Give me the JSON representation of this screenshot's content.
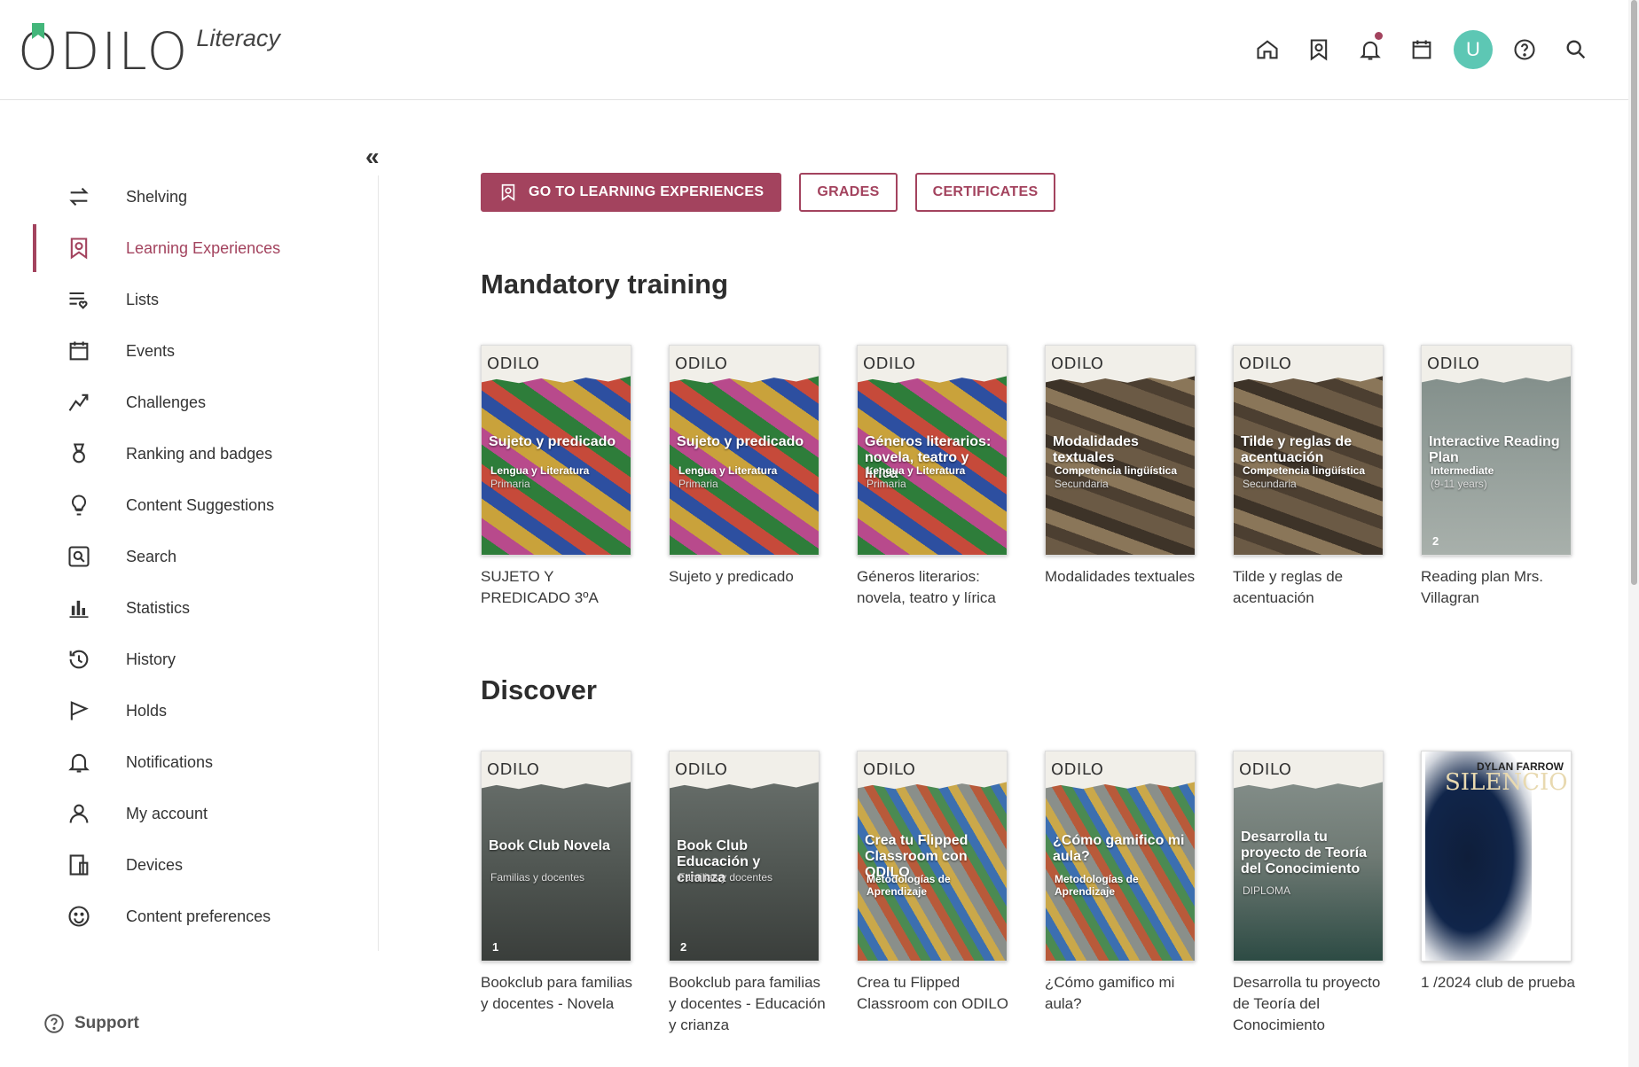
{
  "app": {
    "logo": "ODILO",
    "subtitle": "Literacy"
  },
  "header": {
    "icons": [
      "home-icon",
      "bookmark-icon",
      "bell-icon",
      "calendar-icon",
      "avatar",
      "help-icon",
      "search-icon"
    ],
    "avatar_letter": "U"
  },
  "sidebar": {
    "collapse_label": "«",
    "items": [
      {
        "label": "Shelving",
        "icon": "swap-icon"
      },
      {
        "label": "Learning Experiences",
        "icon": "bookmark-icon",
        "active": true
      },
      {
        "label": "Lists",
        "icon": "list-heart-icon"
      },
      {
        "label": "Events",
        "icon": "calendar-icon"
      },
      {
        "label": "Challenges",
        "icon": "challenge-icon"
      },
      {
        "label": "Ranking and badges",
        "icon": "medal-icon"
      },
      {
        "label": "Content Suggestions",
        "icon": "lightbulb-icon"
      },
      {
        "label": "Search",
        "icon": "search-box-icon"
      },
      {
        "label": "Statistics",
        "icon": "bar-chart-icon"
      },
      {
        "label": "History",
        "icon": "history-icon"
      },
      {
        "label": "Holds",
        "icon": "flag-icon"
      },
      {
        "label": "Notifications",
        "icon": "bell-icon"
      },
      {
        "label": "My account",
        "icon": "user-icon"
      },
      {
        "label": "Devices",
        "icon": "devices-icon"
      },
      {
        "label": "Content preferences",
        "icon": "smiley-icon"
      }
    ],
    "support_label": "Support"
  },
  "main": {
    "buttons": {
      "learning": "GO TO LEARNING EXPERIENCES",
      "grades": "GRADES",
      "certificates": "CERTIFICATES"
    },
    "sections": [
      {
        "title": "Mandatory training",
        "books": [
          {
            "cover_title": "Sujeto y predicado",
            "cover_sub": "Lengua y Literatura",
            "cover_sub2": "Primaria",
            "title": "SUJETO Y PREDICADO 3ºA",
            "bg": "letters"
          },
          {
            "cover_title": "Sujeto y predicado",
            "cover_sub": "Lengua y Literatura",
            "cover_sub2": "Primaria",
            "title": "Sujeto y predicado",
            "bg": "letters"
          },
          {
            "cover_title": "Géneros literarios: novela, teatro y lírica",
            "cover_sub": "Lengua y Literatura",
            "cover_sub2": "Primaria",
            "title": "Géneros literarios: novela, teatro y lírica",
            "bg": "letters"
          },
          {
            "cover_title": "Modalidades textuales",
            "cover_sub": "Competencia lingüística",
            "cover_sub2": "Secundaria",
            "title": "Modalidades textuales",
            "bg": "wood"
          },
          {
            "cover_title": "Tilde y reglas de acentuación",
            "cover_sub": "Competencia lingüística",
            "cover_sub2": "Secundaria",
            "title": "Tilde y reglas de acentuación",
            "bg": "wood"
          },
          {
            "cover_title": "Interactive Reading Plan",
            "cover_sub": "Intermediate",
            "cover_sub2": "(9-11 years)",
            "cover_num": "2",
            "title": "Reading plan Mrs. Villagran",
            "bg": "reading"
          }
        ]
      },
      {
        "title": "Discover",
        "books": [
          {
            "cover_title": "Book Club Novela",
            "cover_sub": "",
            "cover_sub2": "Familias y docentes",
            "cover_num": "1",
            "title": "Bookclub para familias y docentes - Novela",
            "bg": "club"
          },
          {
            "cover_title": "Book Club Educación y crianza",
            "cover_sub": "",
            "cover_sub2": "Familias y docentes",
            "cover_num": "2",
            "title": "Bookclub para familias y docentes - Educación y crianza",
            "bg": "club"
          },
          {
            "cover_title": "Crea tu Flipped Classroom con ODILO",
            "cover_sub": "Metodologías de Aprendizaje",
            "cover_sub2": "",
            "title": "Crea tu Flipped Classroom con ODILO",
            "bg": "ropes"
          },
          {
            "cover_title": "¿Cómo gamifico mi aula?",
            "cover_sub": "Metodologías de Aprendizaje",
            "cover_sub2": "",
            "title": "¿Cómo gamifico mi aula?",
            "bg": "ropes"
          },
          {
            "cover_title": "Desarrolla tu proyecto de Teoría del Conocimiento",
            "cover_sub": "",
            "cover_sub2": "DIPLOMA",
            "title": "Desarrolla tu proyecto de Teoría del Conocimiento",
            "bg": "grad"
          },
          {
            "special": "silencio",
            "author": "DYLAN FARROW",
            "word": "SILENCIO",
            "title": "1 /2024 club de prueba"
          }
        ]
      }
    ]
  },
  "cover_brand": "ODILO",
  "colors": {
    "accent": "#a3435e",
    "avatar": "#5dc7b4",
    "logo_mark": "#43b67a"
  }
}
